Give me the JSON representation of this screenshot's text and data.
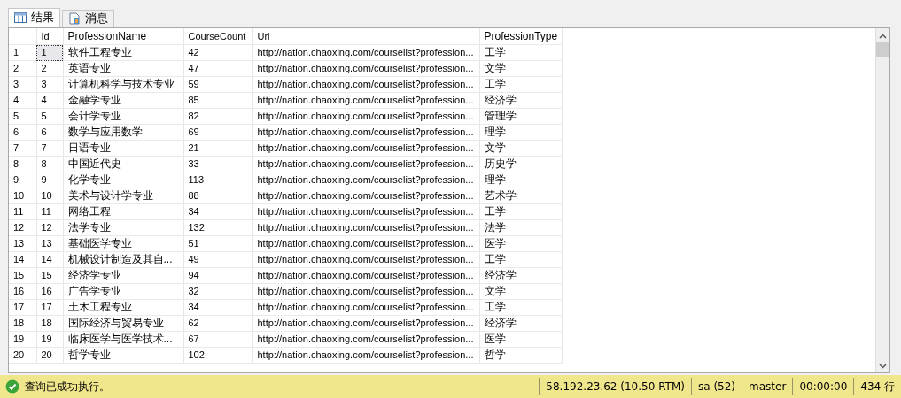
{
  "tabs": [
    {
      "label": "结果",
      "selected": true
    },
    {
      "label": "消息",
      "selected": false
    }
  ],
  "grid": {
    "columns": [
      "Id",
      "ProfessionName",
      "CourseCount",
      "Url",
      "ProfessionType"
    ],
    "rows": [
      {
        "number": "1",
        "cells": [
          "1",
          "软件工程专业",
          "42",
          "http://nation.chaoxing.com/courselist?profession...",
          "工学"
        ],
        "selected": true
      },
      {
        "number": "2",
        "cells": [
          "2",
          "英语专业",
          "47",
          "http://nation.chaoxing.com/courselist?profession...",
          "文学"
        ],
        "selected": false
      },
      {
        "number": "3",
        "cells": [
          "3",
          "计算机科学与技术专业",
          "59",
          "http://nation.chaoxing.com/courselist?profession...",
          "工学"
        ],
        "selected": false
      },
      {
        "number": "4",
        "cells": [
          "4",
          "金融学专业",
          "85",
          "http://nation.chaoxing.com/courselist?profession...",
          "经济学"
        ],
        "selected": false
      },
      {
        "number": "5",
        "cells": [
          "5",
          "会计学专业",
          "82",
          "http://nation.chaoxing.com/courselist?profession...",
          "管理学"
        ],
        "selected": false
      },
      {
        "number": "6",
        "cells": [
          "6",
          "数学与应用数学",
          "69",
          "http://nation.chaoxing.com/courselist?profession...",
          "理学"
        ],
        "selected": false
      },
      {
        "number": "7",
        "cells": [
          "7",
          "日语专业",
          "21",
          "http://nation.chaoxing.com/courselist?profession...",
          "文学"
        ],
        "selected": false
      },
      {
        "number": "8",
        "cells": [
          "8",
          "中国近代史",
          "33",
          "http://nation.chaoxing.com/courselist?profession...",
          "历史学"
        ],
        "selected": false
      },
      {
        "number": "9",
        "cells": [
          "9",
          "化学专业",
          "113",
          "http://nation.chaoxing.com/courselist?profession...",
          "理学"
        ],
        "selected": false
      },
      {
        "number": "10",
        "cells": [
          "10",
          "美术与设计学专业",
          "88",
          "http://nation.chaoxing.com/courselist?profession...",
          "艺术学"
        ],
        "selected": false
      },
      {
        "number": "11",
        "cells": [
          "11",
          "网络工程",
          "34",
          "http://nation.chaoxing.com/courselist?profession...",
          "工学"
        ],
        "selected": false
      },
      {
        "number": "12",
        "cells": [
          "12",
          "法学专业",
          "132",
          "http://nation.chaoxing.com/courselist?profession...",
          "法学"
        ],
        "selected": false
      },
      {
        "number": "13",
        "cells": [
          "13",
          "基础医学专业",
          "51",
          "http://nation.chaoxing.com/courselist?profession...",
          "医学"
        ],
        "selected": false
      },
      {
        "number": "14",
        "cells": [
          "14",
          "机械设计制造及其自...",
          "49",
          "http://nation.chaoxing.com/courselist?profession...",
          "工学"
        ],
        "selected": false
      },
      {
        "number": "15",
        "cells": [
          "15",
          "经济学专业",
          "94",
          "http://nation.chaoxing.com/courselist?profession...",
          "经济学"
        ],
        "selected": false
      },
      {
        "number": "16",
        "cells": [
          "16",
          "广告学专业",
          "32",
          "http://nation.chaoxing.com/courselist?profession...",
          "文学"
        ],
        "selected": false
      },
      {
        "number": "17",
        "cells": [
          "17",
          "土木工程专业",
          "34",
          "http://nation.chaoxing.com/courselist?profession...",
          "工学"
        ],
        "selected": false
      },
      {
        "number": "18",
        "cells": [
          "18",
          "国际经济与贸易专业",
          "62",
          "http://nation.chaoxing.com/courselist?profession...",
          "经济学"
        ],
        "selected": false
      },
      {
        "number": "19",
        "cells": [
          "19",
          "临床医学与医学技术...",
          "67",
          "http://nation.chaoxing.com/courselist?profession...",
          "医学"
        ],
        "selected": false
      },
      {
        "number": "20",
        "cells": [
          "20",
          "哲学专业",
          "102",
          "http://nation.chaoxing.com/courselist?profession...",
          "哲学"
        ],
        "selected": false
      }
    ]
  },
  "status_bar": {
    "message": "查询已成功执行。",
    "fields": [
      "58.192.23.62 (10.50 RTM)",
      "sa (52)",
      "master",
      "00:00:00",
      "434 行"
    ]
  }
}
